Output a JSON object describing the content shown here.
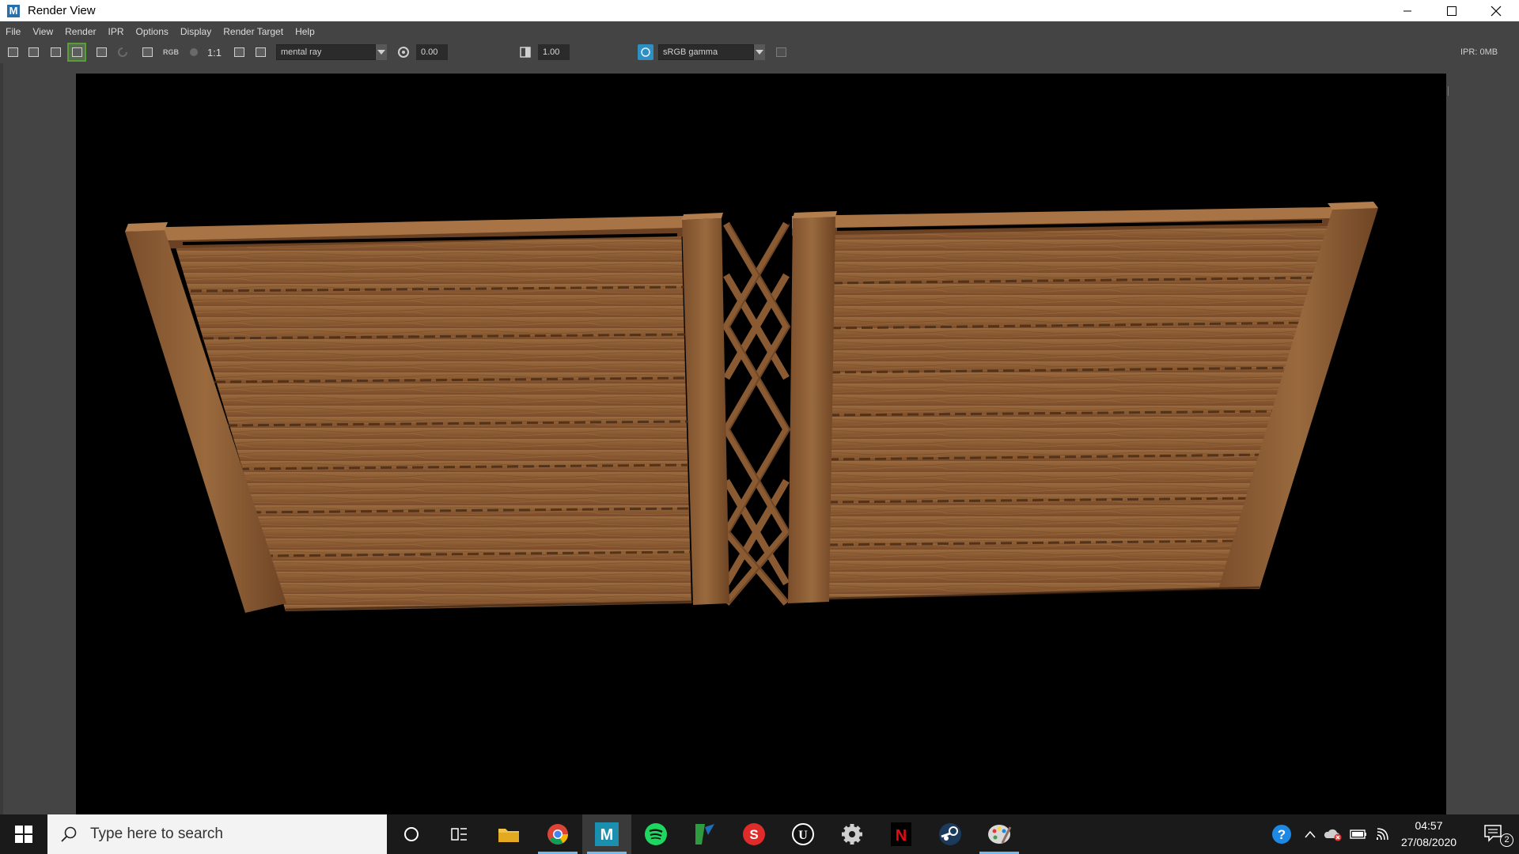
{
  "window": {
    "title": "Render View",
    "app_letter": "M"
  },
  "menu": [
    "File",
    "View",
    "Render",
    "IPR",
    "Options",
    "Display",
    "Render Target",
    "Help"
  ],
  "toolbar": {
    "rgb_label": "RGB",
    "ratio_label": "1:1",
    "renderer": "mental ray",
    "exposure_value": "0.00",
    "gamma_value": "1.00",
    "color_space": "sRGB gamma",
    "ipr_memory": "IPR: 0MB"
  },
  "taskbar": {
    "search_placeholder": "Type here to search",
    "time": "04:57",
    "date": "27/08/2020",
    "notification_count": "2",
    "apps": [
      "cortana",
      "task-view",
      "file-explorer",
      "chrome",
      "maya",
      "spotify",
      "krita",
      "substance-painter",
      "unreal-engine",
      "settings",
      "netflix",
      "steam",
      "paint"
    ]
  },
  "colors": {
    "maya_blue": "#2a6fa8",
    "viewport_bg": "#000000",
    "wood": "#8a5a32",
    "taskbar": "#1a1a1a"
  }
}
